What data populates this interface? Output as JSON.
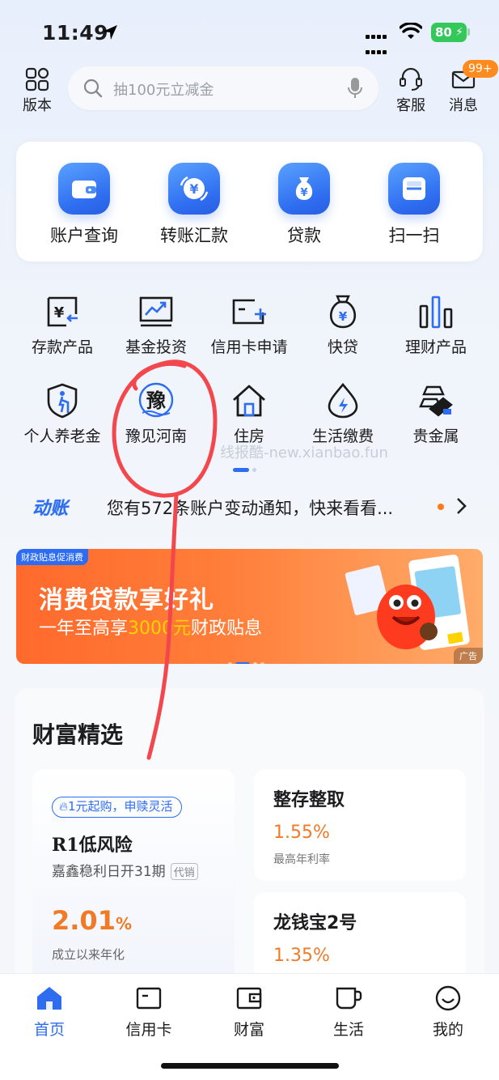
{
  "status_bar": {
    "time": "11:49",
    "battery": "80"
  },
  "header": {
    "left_button": {
      "label": "版本",
      "icon": "version-icon"
    },
    "search": {
      "placeholder": "抽100元立减金"
    },
    "service_button": {
      "label": "客服",
      "icon": "headset-icon"
    },
    "message_button": {
      "label": "消息",
      "icon": "mail-icon",
      "badge": "99+"
    }
  },
  "main_functions": [
    {
      "label": "账户查询",
      "icon": "wallet-icon"
    },
    {
      "label": "转账汇款",
      "icon": "transfer-yuan-icon"
    },
    {
      "label": "贷款",
      "icon": "money-bag-icon"
    },
    {
      "label": "扫一扫",
      "icon": "scan-icon"
    }
  ],
  "grid_row1": [
    {
      "label": "存款产品",
      "icon": "deposit-icon"
    },
    {
      "label": "基金投资",
      "icon": "fund-chart-icon"
    },
    {
      "label": "信用卡申请",
      "icon": "credit-card-add-icon"
    },
    {
      "label": "快贷",
      "icon": "quick-loan-icon"
    },
    {
      "label": "理财产品",
      "icon": "bar-chart-icon"
    }
  ],
  "grid_row2": [
    {
      "label": "个人养老金",
      "icon": "pension-icon"
    },
    {
      "label": "豫见河南",
      "icon": "yu-henan-icon",
      "glyph": "豫"
    },
    {
      "label": "住房",
      "icon": "house-icon"
    },
    {
      "label": "生活缴费",
      "icon": "utility-icon"
    },
    {
      "label": "贵金属",
      "icon": "gold-bars-icon"
    }
  ],
  "watermark": "线报酷-new.xianbao.fun",
  "notice": {
    "logo": "动账",
    "text": "您有572条账户变动通知，快来看看..."
  },
  "banner": {
    "tag": "财政贴息促消费",
    "title": "消费贷款享好礼",
    "sub_prefix": "一年至高享",
    "sub_highlight": "3000元",
    "sub_suffix": "财政贴息",
    "ad_label": "广告"
  },
  "wealth": {
    "title": "财富精选",
    "featured": {
      "pill": "1元起购，申赎灵活",
      "name": "R1低风险",
      "desc": "嘉鑫稳利日开31期",
      "tag": "代销",
      "rate": "2.01",
      "rate_unit": "%",
      "rate_label": "成立以来年化"
    },
    "products": [
      {
        "name": "整存整取",
        "rate": "1.55%",
        "rate_label": "最高年利率"
      },
      {
        "name": "龙钱宝2号",
        "rate": "1.35%"
      }
    ]
  },
  "tab_bar": [
    {
      "label": "首页",
      "icon": "home-icon",
      "active": true
    },
    {
      "label": "信用卡",
      "icon": "credit-card-icon",
      "active": false
    },
    {
      "label": "财富",
      "icon": "wealth-wallet-icon",
      "active": false
    },
    {
      "label": "生活",
      "icon": "mug-icon",
      "active": false
    },
    {
      "label": "我的",
      "icon": "smile-icon",
      "active": false
    }
  ],
  "colors": {
    "accent": "#2e6df0",
    "orange": "#f07a26",
    "annotation": "#f2484d"
  }
}
